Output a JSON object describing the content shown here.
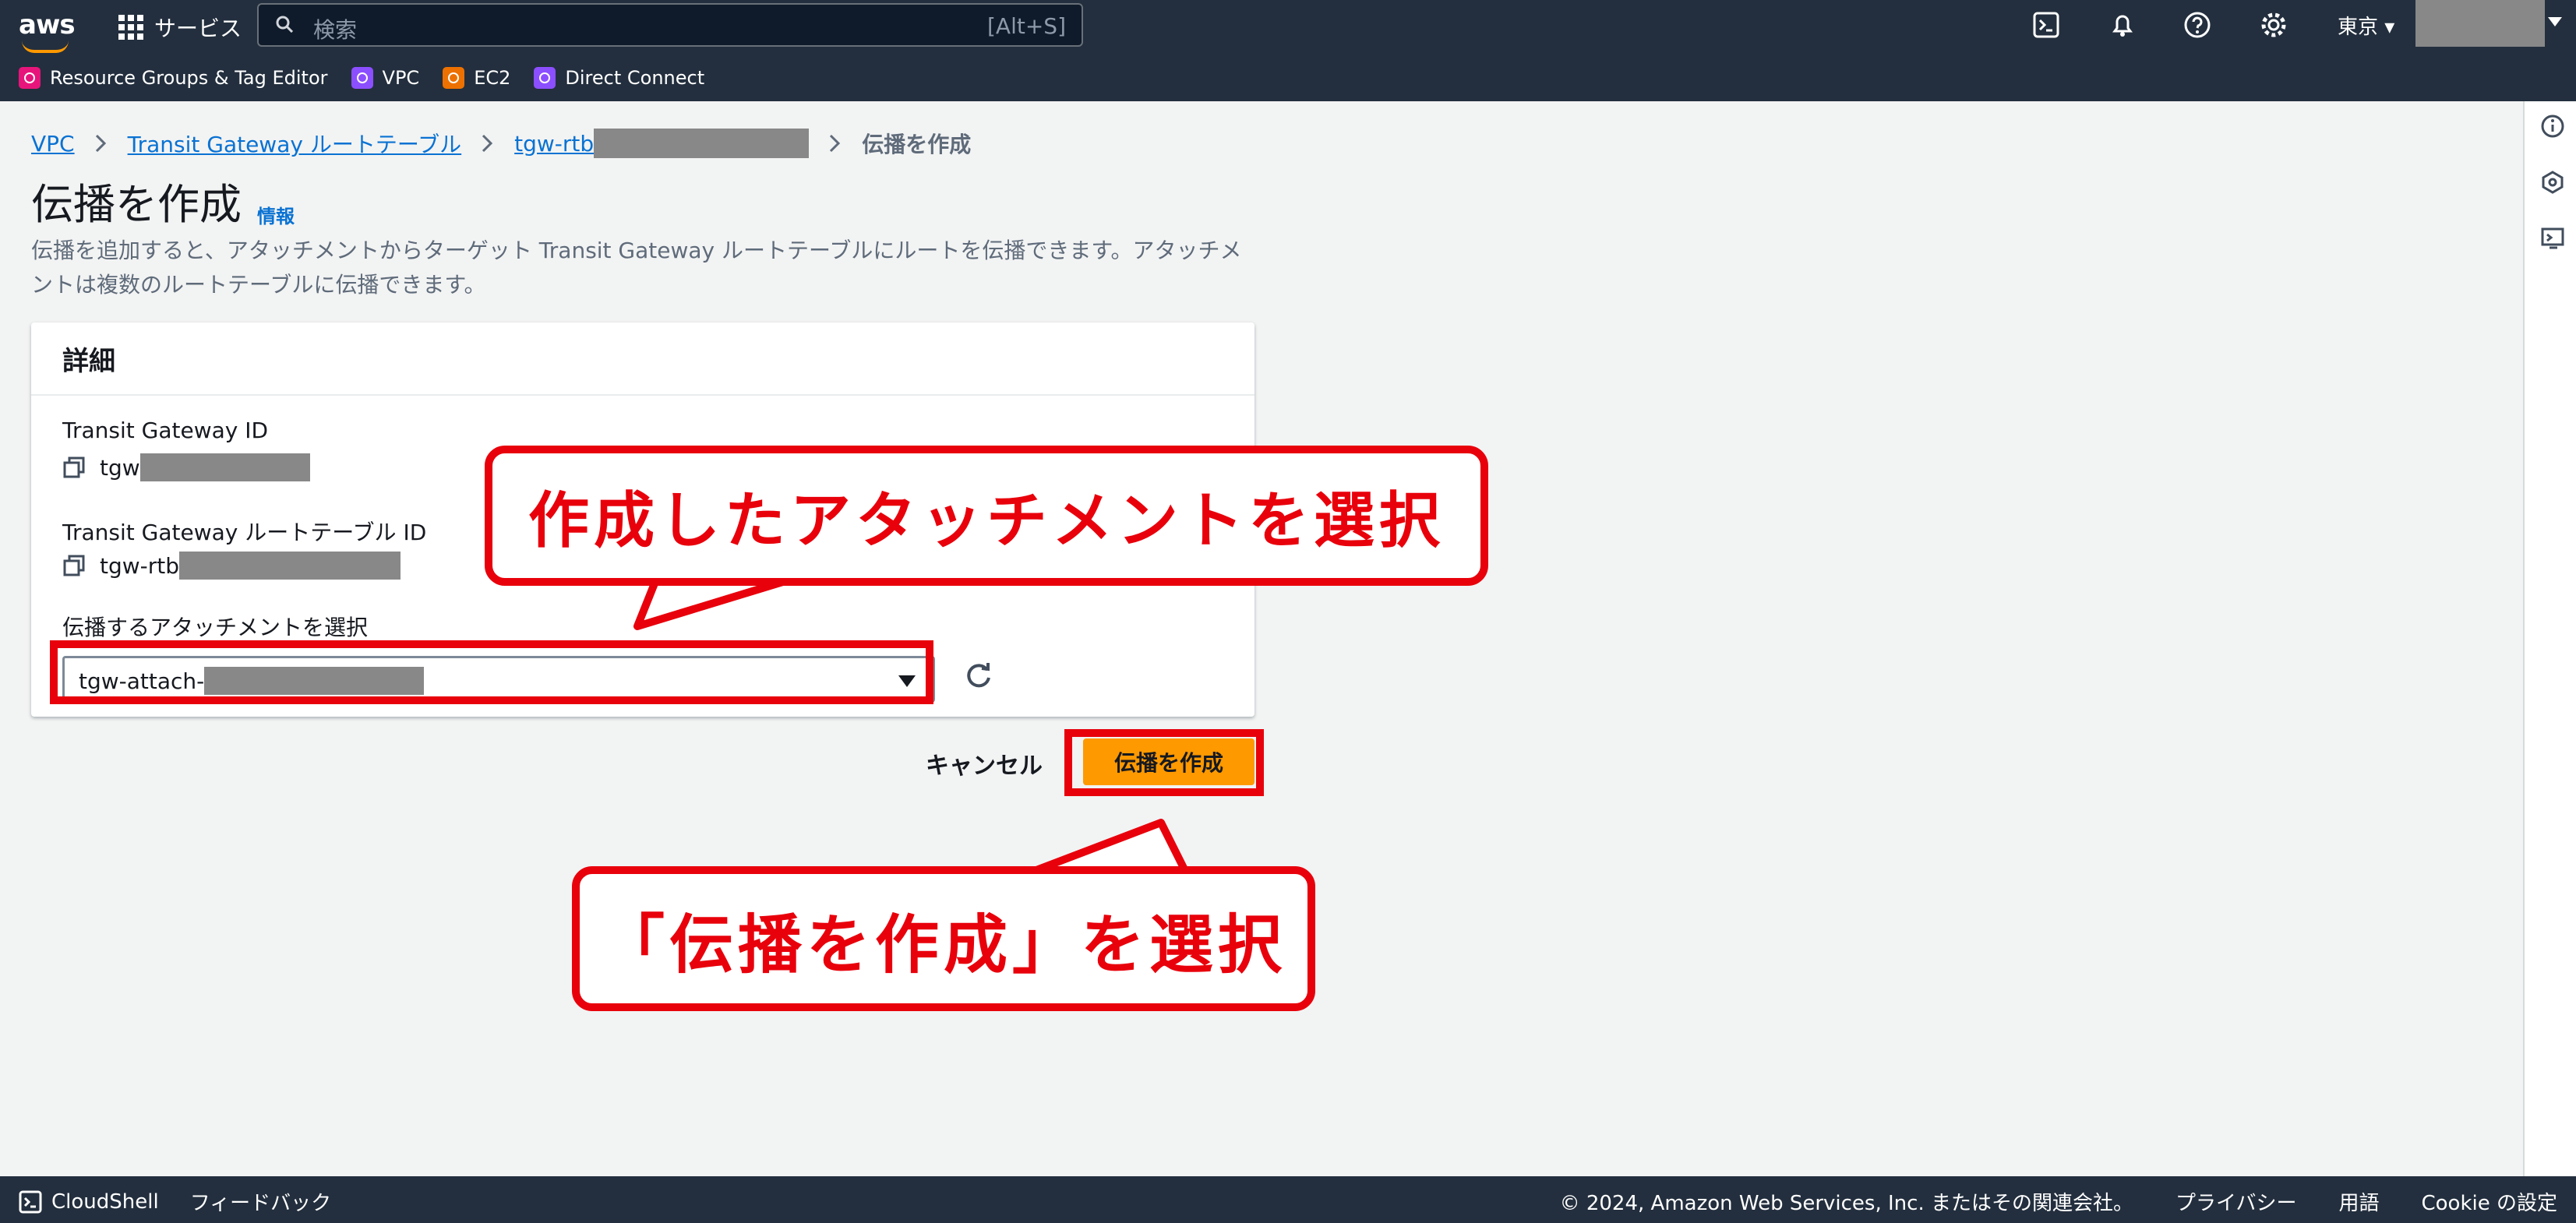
{
  "topbar": {
    "logo": "aws",
    "services_label": "サービス",
    "search_placeholder": "検索",
    "search_shortcut": "[Alt+S]",
    "region": "東京 ▾",
    "icons": [
      "cloudshell-icon",
      "bell-icon",
      "help-icon",
      "gear-icon"
    ]
  },
  "favorites": [
    {
      "label": "Resource Groups & Tag Editor",
      "color": "#e7157b"
    },
    {
      "label": "VPC",
      "color": "#8c4fff"
    },
    {
      "label": "EC2",
      "color": "#ed7100"
    },
    {
      "label": "Direct Connect",
      "color": "#8c4fff"
    }
  ],
  "breadcrumb": {
    "items": [
      "VPC",
      "Transit Gateway ルートテーブル",
      "tgw-rtb"
    ],
    "current": "伝播を作成"
  },
  "page": {
    "title": "伝播を作成",
    "info": "情報",
    "description": "伝播を追加すると、アタッチメントからターゲット Transit Gateway ルートテーブルにルートを伝播できます。アタッチメントは複数のルートテーブルに伝播できます。"
  },
  "details": {
    "header": "詳細",
    "tgw_id_label": "Transit Gateway ID",
    "tgw_id_value": "tgw",
    "rtb_id_label": "Transit Gateway ルートテーブル ID",
    "rtb_id_value": "tgw-rtb",
    "attach_label": "伝播するアタッチメントを選択",
    "attach_value": "tgw-attach-"
  },
  "actions": {
    "cancel": "キャンセル",
    "create": "伝播を作成"
  },
  "annotations": {
    "callout_top": "作成したアタッチメントを選択",
    "callout_bottom": "「伝播を作成」を選択",
    "color": "#e8000b"
  },
  "footer": {
    "cloudshell": "CloudShell",
    "feedback": "フィードバック",
    "copyright": "© 2024, Amazon Web Services, Inc. またはその関連会社。",
    "privacy": "プライバシー",
    "terms": "用語",
    "cookie": "Cookie の設定"
  }
}
